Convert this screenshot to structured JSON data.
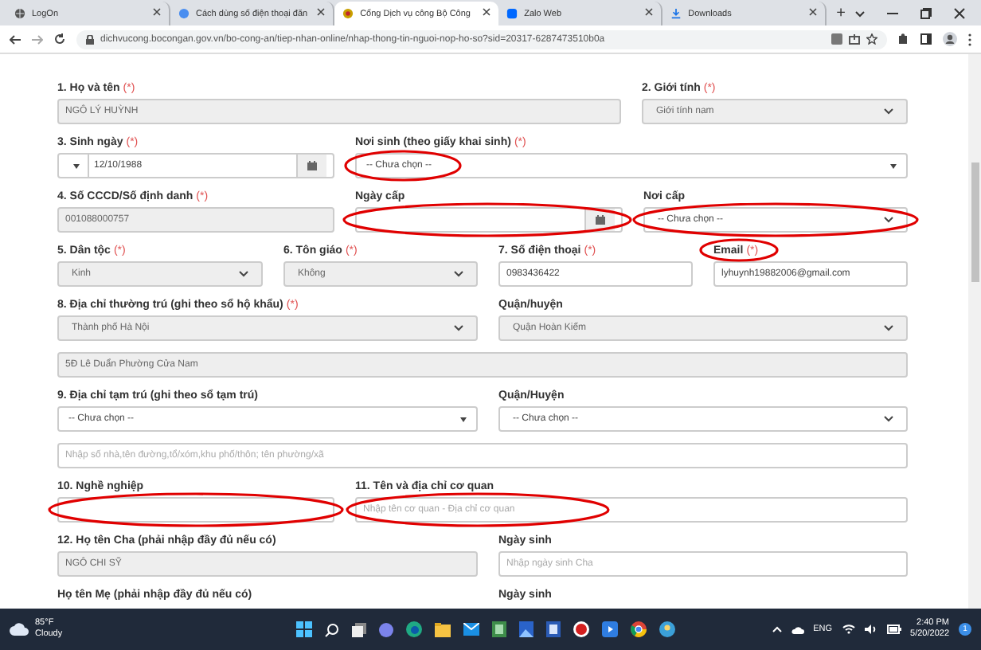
{
  "browser": {
    "tabs": [
      {
        "title": "LogOn",
        "selected": false
      },
      {
        "title": "Cách dùng số điện thoại đăn",
        "selected": false
      },
      {
        "title": "Cổng Dịch vụ công Bộ Công",
        "selected": true
      },
      {
        "title": "Zalo Web",
        "selected": false
      },
      {
        "title": "Downloads",
        "selected": false
      }
    ],
    "new_tab": "+",
    "url": "dichvucong.bocongan.gov.vn/bo-cong-an/tiep-nhan-online/nhap-thong-tin-nguoi-nop-ho-so?sid=20317-6287473510b0a"
  },
  "form": {
    "rows": [
      {
        "fields": [
          {
            "label": "1. Họ và tên",
            "mark": "(*)",
            "kind": "text",
            "value": "NGÔ LÝ HUỲNH",
            "disabled": true
          },
          {
            "label": "2. Giới tính",
            "mark": "(*)",
            "kind": "select",
            "value": "Giới tính nam",
            "disabled": true
          }
        ]
      },
      {
        "fields": [
          {
            "label": "3. Sinh ngày",
            "mark": "(*)",
            "kind": "date-picker",
            "value": "12/10/1988",
            "disabled": false
          },
          {
            "label": "Nơi sinh (theo giấy khai sinh)",
            "mark": "(*)",
            "kind": "combobox",
            "value": "-- Chưa chọn --",
            "disabled": false
          }
        ]
      },
      {
        "fields": [
          {
            "label": "4. Số CCCD/Số định danh",
            "mark": "(*)",
            "kind": "text",
            "value": "001088000757",
            "disabled": true
          },
          {
            "label": "Ngày cấp",
            "kind": "date",
            "disabled": false
          },
          {
            "label": "Nơi cấp",
            "kind": "select",
            "value": "-- Chưa chọn --",
            "disabled": false
          }
        ]
      },
      {
        "fields": [
          {
            "label": "5. Dân tộc",
            "mark": "(*)",
            "kind": "select",
            "value": "Kinh",
            "disabled": true
          },
          {
            "label": "6. Tôn giáo",
            "mark": "(*)",
            "kind": "select",
            "value": "Không",
            "disabled": true
          },
          {
            "label": "7. Số điện thoại",
            "mark": "(*)",
            "kind": "text",
            "value": "0983436422",
            "disabled": false
          },
          {
            "label": "Email",
            "mark": "(*)",
            "kind": "text",
            "value": "lyhuynh19882006@gmail.com",
            "disabled": false
          }
        ]
      },
      {
        "fields": [
          {
            "label": "8. Địa chỉ thường trú (ghi theo sổ hộ khẩu)",
            "mark": "(*)",
            "kind": "select",
            "value": "Thành phố Hà Nội",
            "disabled": true
          },
          {
            "label": "Quận/huyện",
            "kind": "select",
            "value": "Quận Hoàn Kiếm",
            "disabled": true
          }
        ]
      },
      {
        "fields": [
          {
            "kind": "text",
            "value": "5Đ Lê Duẩn Phường Cửa Nam",
            "disabled": true
          }
        ]
      },
      {
        "fields": [
          {
            "label": "9. Địa chỉ tạm trú (ghi theo sổ tạm trú)",
            "kind": "combobox",
            "value": "-- Chưa chọn --",
            "disabled": false
          },
          {
            "label": "Quận/Huyện",
            "kind": "select",
            "value": "-- Chưa chọn --",
            "disabled": false
          }
        ]
      },
      {
        "fields": [
          {
            "kind": "text",
            "placeholder": "Nhập số nhà,tên đường,tổ/xóm,khu phố/thôn; tên phường/xã",
            "disabled": false
          }
        ]
      },
      {
        "fields": [
          {
            "label": "10. Nghề nghiệp",
            "kind": "text",
            "disabled": false
          },
          {
            "label": "11. Tên và địa chỉ cơ quan",
            "kind": "text",
            "placeholder": "Nhập tên cơ quan - Địa chỉ cơ quan",
            "disabled": false
          }
        ]
      },
      {
        "fields": [
          {
            "label": "12. Họ tên Cha (phải nhập đầy đủ nếu có)",
            "kind": "text",
            "value": "NGÔ CHI SỸ",
            "disabled": true
          },
          {
            "label": "Ngày sinh",
            "kind": "text",
            "placeholder": "Nhập ngày sinh Cha",
            "disabled": false
          }
        ]
      },
      {
        "fields": [
          {
            "label": "Họ tên Mẹ (phải nhập đầy đủ nếu có)",
            "kind": "label"
          },
          {
            "label": "Ngày sinh",
            "kind": "label"
          }
        ]
      }
    ]
  },
  "taskbar": {
    "temperature": "85°F",
    "weather": "Cloudy",
    "language": "ENG",
    "time": "2:40 PM",
    "date": "5/20/2022",
    "notifications": "1"
  }
}
